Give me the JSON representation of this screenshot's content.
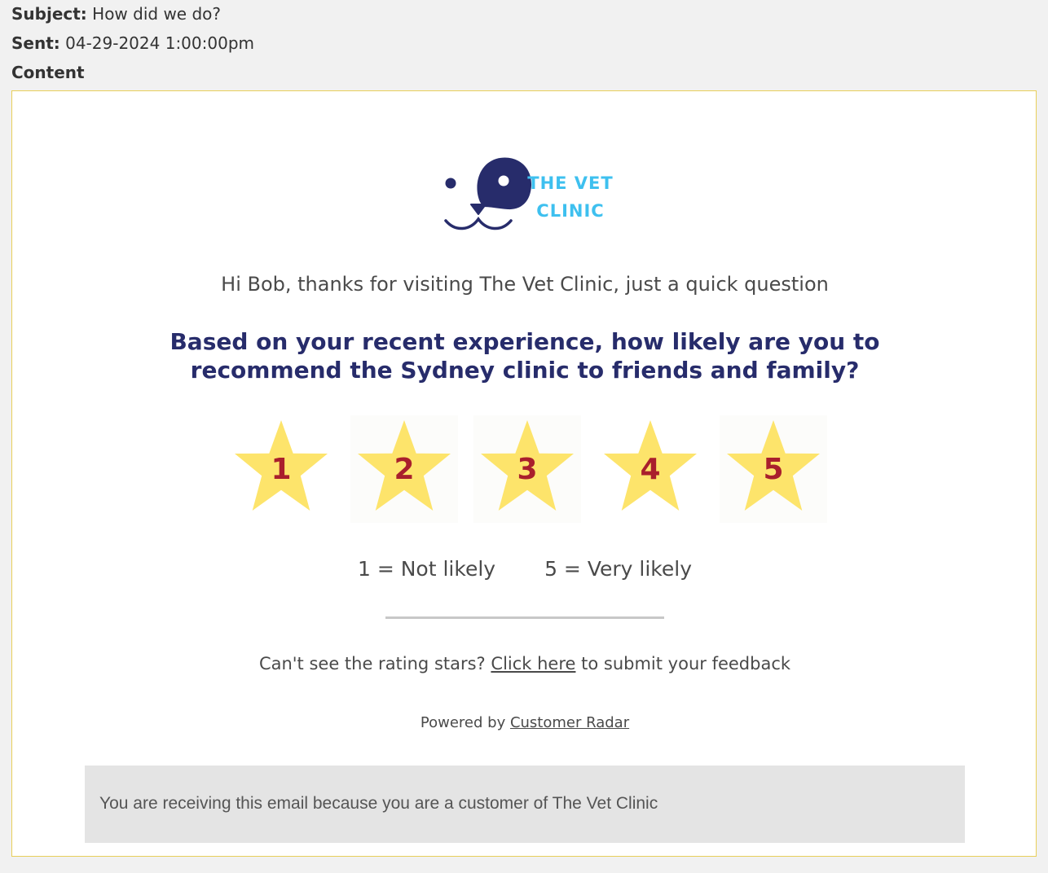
{
  "header": {
    "subject_label": "Subject:",
    "subject_value": "How did we do?",
    "sent_label": "Sent:",
    "sent_value": "04-29-2024 1:00:00pm",
    "content_label": "Content"
  },
  "email": {
    "logo": {
      "line1": "THE VET",
      "line2": "CLINIC",
      "icon": "dog-face-icon",
      "colors": {
        "navy": "#272c6b",
        "cyan": "#3ec0ef"
      }
    },
    "greeting": "Hi Bob, thanks for visiting The Vet Clinic, just a quick question",
    "question": "Based on your recent experience, how likely are you to recommend the Sydney clinic to friends and family?",
    "stars": [
      {
        "label": "1",
        "icon": "star-icon"
      },
      {
        "label": "2",
        "icon": "star-icon"
      },
      {
        "label": "3",
        "icon": "star-icon"
      },
      {
        "label": "4",
        "icon": "star-icon"
      },
      {
        "label": "5",
        "icon": "star-icon"
      }
    ],
    "star_colors": {
      "fill": "#fde46b",
      "number": "#a91f2c"
    },
    "scale_low": "1 = Not likely",
    "scale_high": "5 = Very likely",
    "fallback_prefix": "Can't see the rating stars?",
    "fallback_link": "Click here",
    "fallback_suffix": "to submit your feedback",
    "powered_prefix": "Powered by",
    "powered_link": "Customer Radar",
    "footer": "You are receiving this email because you are a customer of The Vet Clinic"
  }
}
